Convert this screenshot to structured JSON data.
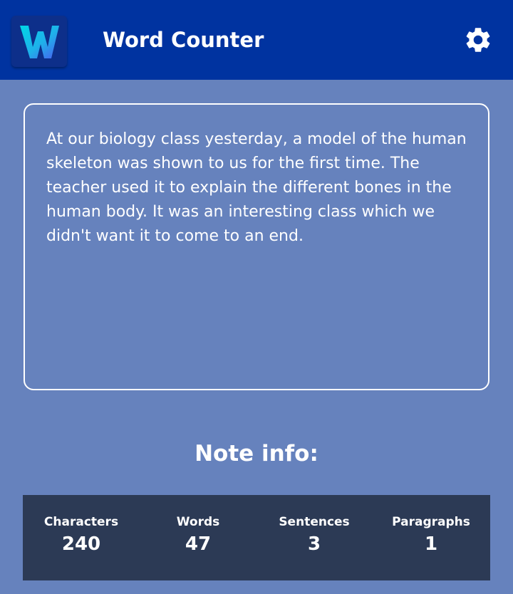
{
  "header": {
    "title": "Word Counter",
    "logo_letter": "W",
    "settings_icon": "gear-icon"
  },
  "note": {
    "text": "At our biology class yesterday, a model of the human skeleton was shown to us for the first time. The teacher used it to explain the different bones in the human body. It was an interesting class which we didn't want it to come to an end."
  },
  "note_info": {
    "title": "Note info:",
    "stats": [
      {
        "label": "Characters",
        "value": "240"
      },
      {
        "label": "Words",
        "value": "47"
      },
      {
        "label": "Sentences",
        "value": "3"
      },
      {
        "label": "Paragraphs",
        "value": "1"
      }
    ]
  },
  "colors": {
    "app_bar": "#0033a0",
    "background": "#6682bd",
    "stats_panel": "#2c3a55",
    "logo_gradient_start": "#00d6e6",
    "logo_gradient_end": "#4a5cf0"
  }
}
